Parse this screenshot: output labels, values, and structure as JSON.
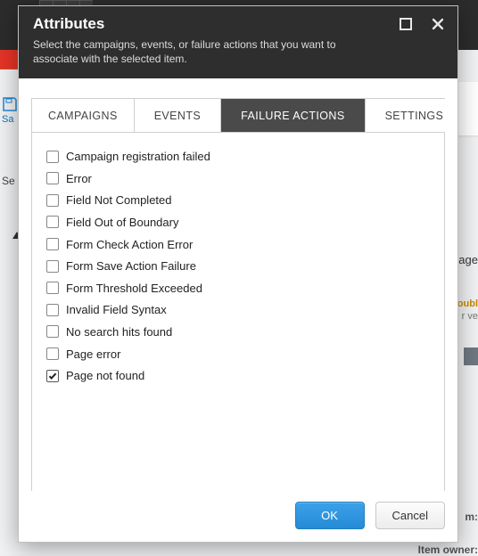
{
  "background": {
    "save_label": "Sa",
    "search_prefix": "Se",
    "right_word_fragment": "age",
    "right_bold1": "oubl",
    "right_muted": "r ve",
    "label_m": "m:",
    "label_owner": "Item owner:"
  },
  "modal": {
    "title": "Attributes",
    "subtitle": "Select the campaigns, events, or failure actions that you want to associate with the selected item.",
    "tabs": [
      {
        "label": "CAMPAIGNS",
        "active": false
      },
      {
        "label": "EVENTS",
        "active": false
      },
      {
        "label": "FAILURE ACTIONS",
        "active": true
      },
      {
        "label": "SETTINGS",
        "active": false
      }
    ],
    "failure_actions": [
      {
        "label": "Campaign registration failed",
        "checked": false
      },
      {
        "label": "Error",
        "checked": false
      },
      {
        "label": "Field Not Completed",
        "checked": false
      },
      {
        "label": "Field Out of Boundary",
        "checked": false
      },
      {
        "label": "Form Check Action Error",
        "checked": false
      },
      {
        "label": "Form Save Action Failure",
        "checked": false
      },
      {
        "label": "Form Threshold Exceeded",
        "checked": false
      },
      {
        "label": "Invalid Field Syntax",
        "checked": false
      },
      {
        "label": "No search hits found",
        "checked": false
      },
      {
        "label": "Page error",
        "checked": false
      },
      {
        "label": "Page not found",
        "checked": true
      }
    ],
    "buttons": {
      "ok": "OK",
      "cancel": "Cancel"
    }
  }
}
